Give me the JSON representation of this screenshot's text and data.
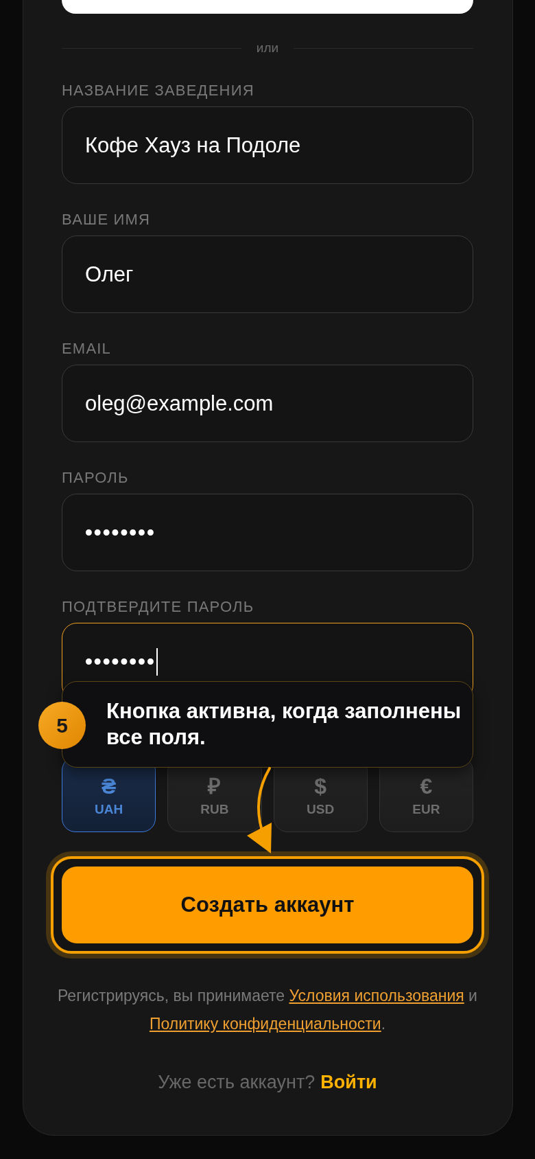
{
  "divider": {
    "label": "или"
  },
  "fields": [
    {
      "label": "НАЗВАНИЕ ЗАВЕДЕНИЯ",
      "value": "Кофе Хауз на Подоле",
      "kind": "text",
      "focused": false
    },
    {
      "label": "ВАШЕ ИМЯ",
      "value": "Олег",
      "kind": "text",
      "focused": false
    },
    {
      "label": "EMAIL",
      "value": "oleg@example.com",
      "kind": "text",
      "focused": false
    },
    {
      "label": "ПАРОЛЬ",
      "value": "••••••••",
      "kind": "password",
      "focused": false
    },
    {
      "label": "ПОДТВЕРДИТЕ ПАРОЛЬ",
      "value": "••••••••",
      "kind": "password",
      "focused": true
    }
  ],
  "tooltip": {
    "step": "5",
    "text": "Кнопка активна, когда заполнены все поля."
  },
  "currencies": [
    {
      "symbol": "₴",
      "code": "UAH",
      "selected": true
    },
    {
      "symbol": "₽",
      "code": "RUB",
      "selected": false
    },
    {
      "symbol": "$",
      "code": "USD",
      "selected": false
    },
    {
      "symbol": "€",
      "code": "EUR",
      "selected": false
    }
  ],
  "submit_button": {
    "label": "Создать аккаунт",
    "highlighted": true
  },
  "terms": {
    "parts": [
      {
        "kind": "text",
        "text": "Регистрируясь, вы принимаете "
      },
      {
        "kind": "link",
        "text": "Условия использования"
      },
      {
        "kind": "text",
        "text": " и "
      },
      {
        "kind": "link",
        "text": "Политику конфиденциальности"
      },
      {
        "kind": "text",
        "text": "."
      }
    ]
  },
  "login": {
    "prompt": "Уже есть аккаунт?",
    "link": "Войти"
  }
}
